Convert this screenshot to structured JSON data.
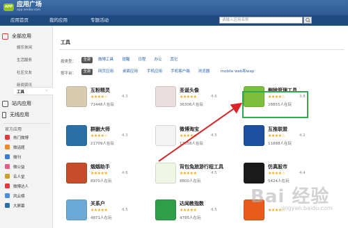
{
  "header": {
    "logo_badge": "APP",
    "title": "应用广场",
    "subtitle": "app.weibo.com",
    "tabs": [
      "应用首页",
      "我的应用",
      "专题活动"
    ],
    "search_placeholder": "请输入应用名称"
  },
  "sidebar": {
    "all_apps": "全部应用",
    "categories": [
      "娱乐休闲",
      "生活服务",
      "社区交友",
      "新闻资讯",
      "工具"
    ],
    "selected_category": "工具",
    "site_apps": "站内应用",
    "wireless_apps": "无线应用",
    "official_header": "官方应用",
    "official_items": [
      "热门微博",
      "微话题",
      "微刊",
      "微公益",
      "名人堂",
      "微博达人",
      "风云榜",
      "大屏幕"
    ]
  },
  "main": {
    "section_title": "工具",
    "filter_type_label": "按类型：",
    "filter_types": [
      "全部",
      "微博工具",
      "提醒",
      "日程",
      "办公",
      "其它"
    ],
    "filter_platform_label": "按平台：",
    "filter_platforms": [
      "全部",
      "网页应用",
      "桌面应用",
      "手机应用",
      "手机客户端",
      "浏览器",
      "mobile web和wap"
    ],
    "apps": [
      {
        "name": "互粉精灵",
        "rating": "4.3",
        "stars": "★★★★☆",
        "users": "71448人在玩",
        "color": "#d9cbb0"
      },
      {
        "name": "圣诞头像",
        "rating": "4.6",
        "stars": "★★★★★",
        "users": "36306人在玩",
        "color": "#eadede"
      },
      {
        "name": "删除管理工具",
        "rating": "3.8",
        "stars": "★★★★☆",
        "users": "28855人在玩",
        "color": "#7cbf3a"
      },
      {
        "name": "群删大师",
        "rating": "4.3",
        "stars": "★★★★☆",
        "users": "21709人在玩",
        "color": "#2a6fa8"
      },
      {
        "name": "微博淘宝",
        "rating": "4.5",
        "stars": "★★★★★",
        "users": "17658人在玩",
        "color": "#f3f3f3"
      },
      {
        "name": "互推联盟",
        "rating": "4.2",
        "stars": "★★★★☆",
        "users": "11888人在玩",
        "color": "#1c4f9e"
      },
      {
        "name": "烟烟助手",
        "rating": "4.6",
        "stars": "★★★★★",
        "users": "8970人在玩",
        "color": "#c74d2a"
      },
      {
        "name": "背包兔旅游行程工具",
        "rating": "4.5",
        "stars": "★★★★★",
        "users": "8800人在玩",
        "color": "#f0f6e4"
      },
      {
        "name": "仿真股市",
        "rating": "4.4",
        "stars": "★★★★☆",
        "users": "5424人在玩",
        "color": "#1a1a1a"
      },
      {
        "name": "关系户",
        "rating": "4.5",
        "stars": "★★★★★",
        "users": "4871人在玩",
        "color": "#6aa9d8"
      },
      {
        "name": "达闻教指数",
        "rating": "4.5",
        "stars": "★★★★★",
        "users": "4785人在玩",
        "color": "#2f9e46"
      },
      {
        "name": "",
        "rating": "",
        "stars": "★★★★☆",
        "users": "",
        "color": "#e85c1b"
      }
    ]
  },
  "watermark": {
    "text": "Bai 经验",
    "sub": "jingyan.baidu.com"
  }
}
